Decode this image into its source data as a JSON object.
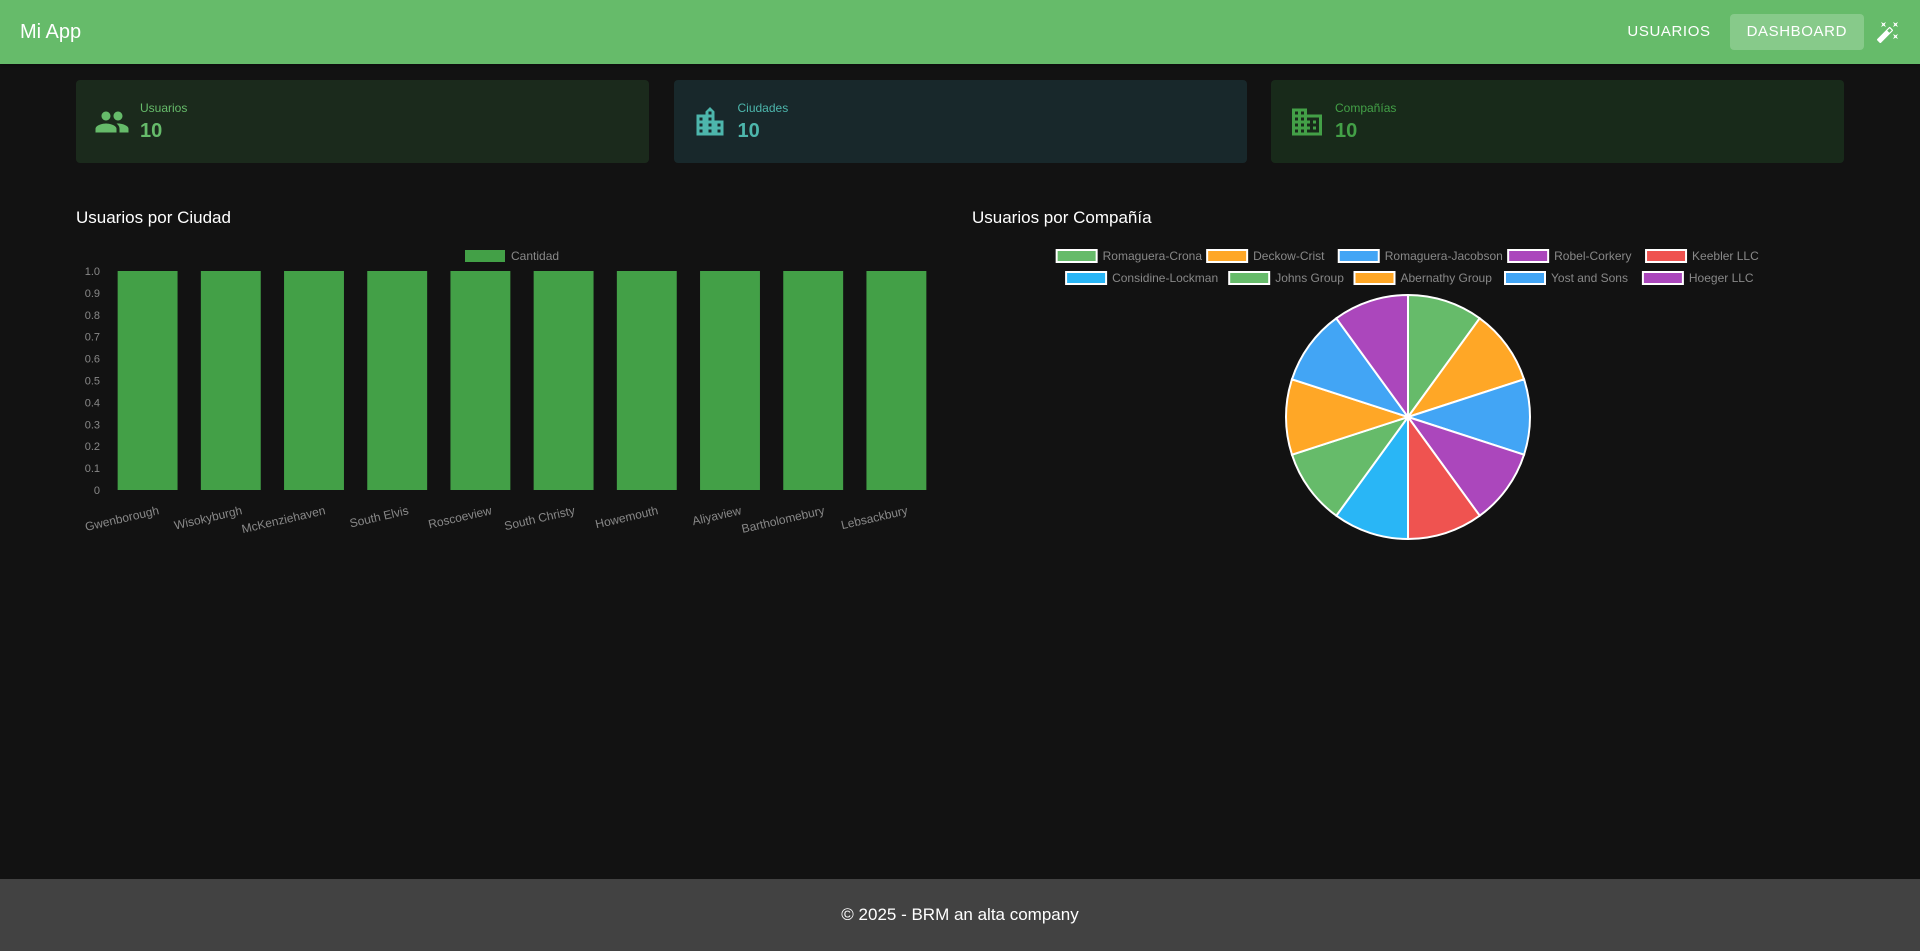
{
  "app": {
    "title": "Mi App"
  },
  "nav": {
    "items": [
      {
        "label": "USUARIOS",
        "active": false
      },
      {
        "label": "DASHBOARD",
        "active": true
      }
    ],
    "theme_icon": "theme-toggle-icon"
  },
  "cards": [
    {
      "label": "Usuarios",
      "value": "10",
      "icon": "people-icon",
      "color": "#66bb6a",
      "bg": "#1b2a1c"
    },
    {
      "label": "Ciudades",
      "value": "10",
      "icon": "city-icon",
      "color": "#4db6ac",
      "bg": "#18282b"
    },
    {
      "label": "Compañías",
      "value": "10",
      "icon": "business-icon",
      "color": "#43a047",
      "bg": "#182a1a"
    }
  ],
  "bar_section": {
    "title": "Usuarios por Ciudad"
  },
  "pie_section": {
    "title": "Usuarios por Compañía"
  },
  "chart_data": [
    {
      "type": "bar",
      "categories": [
        "Gwenborough",
        "Wisokyburgh",
        "McKenziehaven",
        "South Elvis",
        "Roscoeview",
        "South Christy",
        "Howemouth",
        "Aliyaview",
        "Bartholomebury",
        "Lebsackbury"
      ],
      "series": [
        {
          "name": "Cantidad",
          "values": [
            1,
            1,
            1,
            1,
            1,
            1,
            1,
            1,
            1,
            1
          ],
          "color": "#43a047"
        }
      ],
      "yticks": [
        "0",
        "0.1",
        "0.2",
        "0.3",
        "0.4",
        "0.5",
        "0.6",
        "0.7",
        "0.8",
        "0.9",
        "1.0"
      ],
      "ylim": [
        0,
        1
      ],
      "grid": false,
      "legend": "top"
    },
    {
      "type": "pie",
      "labels": [
        "Romaguera-Crona",
        "Deckow-Crist",
        "Romaguera-Jacobson",
        "Robel-Corkery",
        "Keebler LLC",
        "Considine-Lockman",
        "Johns Group",
        "Abernathy Group",
        "Yost and Sons",
        "Hoeger LLC"
      ],
      "values": [
        1,
        1,
        1,
        1,
        1,
        1,
        1,
        1,
        1,
        1
      ],
      "colors": [
        "#66bb6a",
        "#ffa726",
        "#42a5f5",
        "#ab47bc",
        "#ef5350",
        "#29b6f6",
        "#66bb6a",
        "#ffa726",
        "#42a5f5",
        "#ab47bc"
      ],
      "legend": "top"
    }
  ],
  "footer": {
    "text": "© 2025 - BRM an alta company"
  }
}
